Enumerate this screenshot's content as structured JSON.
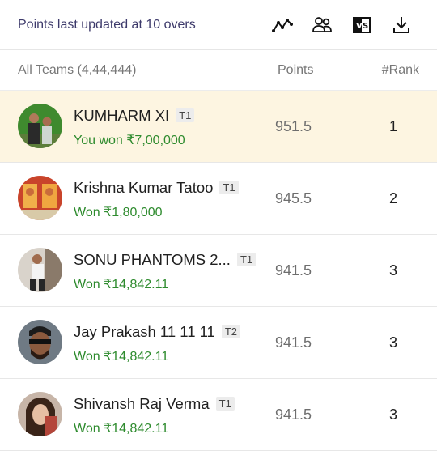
{
  "topbar": {
    "updated_text": "Points last updated at 10 overs",
    "icons": [
      "graph-icon",
      "team-compare-icon",
      "vs-icon",
      "download-icon"
    ]
  },
  "header": {
    "team_label": "All Teams (4,44,444)",
    "points_label": "Points",
    "rank_label": "#Rank"
  },
  "rows": [
    {
      "name": "KUMHARM XI",
      "tag": "T1",
      "won": "You won ₹7,00,000",
      "points": "951.5",
      "rank": "1",
      "highlight": true
    },
    {
      "name": "Krishna Kumar Tatoo",
      "tag": "T1",
      "won": "Won ₹1,80,000",
      "points": "945.5",
      "rank": "2"
    },
    {
      "name": "SONU PHANTOMS 2...",
      "tag": "T1",
      "won": "Won ₹14,842.11",
      "points": "941.5",
      "rank": "3"
    },
    {
      "name": "Jay Prakash 11 11 11",
      "tag": "T2",
      "won": "Won ₹14,842.11",
      "points": "941.5",
      "rank": "3"
    },
    {
      "name": "Shivansh Raj Verma",
      "tag": "T1",
      "won": "Won ₹14,842.11",
      "points": "941.5",
      "rank": "3"
    }
  ],
  "colors": {
    "highlight_bg": "#fdf5e1",
    "won_text": "#2e8b2e",
    "updated_text": "#3d3a6b"
  }
}
